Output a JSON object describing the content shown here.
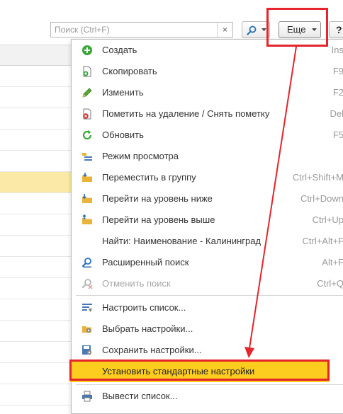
{
  "toolbar": {
    "search_placeholder": "Поиск (Ctrl+F)",
    "clear_symbol": "×",
    "more_label": "Еще",
    "help_label": "?"
  },
  "menu": {
    "items": [
      {
        "label": "Создать",
        "shortcut": "Ins",
        "icon": "plus-circle-icon",
        "enabled": true
      },
      {
        "label": "Скопировать",
        "shortcut": "F9",
        "icon": "copy-document-icon",
        "enabled": true
      },
      {
        "label": "Изменить",
        "shortcut": "F2",
        "icon": "pencil-icon",
        "enabled": true
      },
      {
        "label": "Пометить на удаление / Снять пометку",
        "shortcut": "Del",
        "icon": "delete-mark-icon",
        "enabled": true
      },
      {
        "label": "Обновить",
        "shortcut": "F5",
        "icon": "refresh-icon",
        "enabled": true
      },
      {
        "label": "Режим просмотра",
        "shortcut": "",
        "icon": "view-mode-icon",
        "enabled": true
      },
      {
        "label": "Переместить в группу",
        "shortcut": "Ctrl+Shift+M",
        "icon": "move-to-group-icon",
        "enabled": true
      },
      {
        "label": "Перейти на уровень ниже",
        "shortcut": "Ctrl+Down",
        "icon": "level-down-icon",
        "enabled": true
      },
      {
        "label": "Перейти на уровень выше",
        "shortcut": "Ctrl+Up",
        "icon": "level-up-icon",
        "enabled": true
      },
      {
        "label": "Найти: Наименование - Калининград",
        "shortcut": "Ctrl+Alt+F",
        "icon": "",
        "enabled": true
      },
      {
        "label": "Расширенный поиск",
        "shortcut": "Alt+F",
        "icon": "advanced-search-icon",
        "enabled": true
      },
      {
        "label": "Отменить поиск",
        "shortcut": "Ctrl+Q",
        "icon": "cancel-search-icon",
        "enabled": false
      },
      {
        "label": "Настроить список...",
        "shortcut": "",
        "icon": "configure-list-icon",
        "enabled": true
      },
      {
        "label": "Выбрать настройки...",
        "shortcut": "",
        "icon": "choose-settings-icon",
        "enabled": true
      },
      {
        "label": "Сохранить настройки...",
        "shortcut": "",
        "icon": "save-settings-icon",
        "enabled": true
      },
      {
        "label": "Установить стандартные настройки",
        "shortcut": "",
        "icon": "",
        "enabled": true,
        "highlighted": true
      },
      {
        "label": "Вывести список...",
        "shortcut": "",
        "icon": "print-list-icon",
        "enabled": true
      }
    ]
  },
  "colors": {
    "highlight": "#fccc1f",
    "annotation": "#e5242b",
    "selected_row": "#fbeaa7"
  }
}
